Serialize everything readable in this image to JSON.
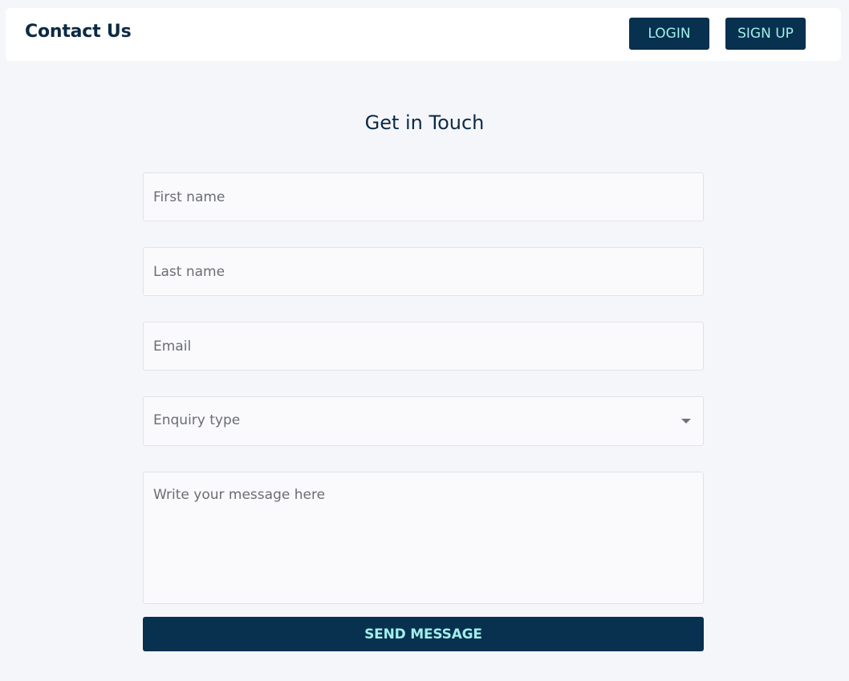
{
  "header": {
    "title": "Contact Us",
    "login_label": "LOGIN",
    "signup_label": "SIGN UP"
  },
  "form": {
    "title": "Get in Touch",
    "first_name": {
      "value": "",
      "placeholder": "First name"
    },
    "last_name": {
      "value": "",
      "placeholder": "Last name"
    },
    "email": {
      "value": "",
      "placeholder": "Email"
    },
    "enquiry_type": {
      "selected": "Enquiry type",
      "icon": "chevron-down-icon"
    },
    "message": {
      "value": "",
      "placeholder": "Write your message here"
    },
    "send_label": "SEND MESSAGE"
  },
  "colors": {
    "page_bg": "#f5f6fa",
    "brand_dark": "#08304f",
    "button_text": "#9ff0e9",
    "field_bg": "#fafafc",
    "field_border": "#e1e3e8",
    "text_dark": "#0b2a45"
  }
}
